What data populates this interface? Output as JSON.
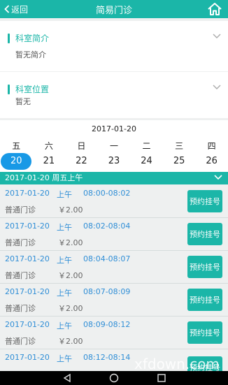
{
  "header": {
    "back_label": "返回",
    "title": "简易门诊"
  },
  "intro": {
    "title": "科室简介",
    "body": "暂无简介"
  },
  "location": {
    "title": "科室位置",
    "body": "暂无"
  },
  "calendar": {
    "selected_date": "2017-01-20",
    "weekdays": [
      "五",
      "六",
      "日",
      "一",
      "二",
      "三",
      "四"
    ],
    "days": [
      "20",
      "21",
      "22",
      "23",
      "24",
      "25",
      "26"
    ],
    "selected_index": 0
  },
  "period": {
    "label": "2017-01-20 周五上午"
  },
  "slots": [
    {
      "date": "2017-01-20",
      "ampm": "上午",
      "time": "08:00-08:02",
      "type": "普通门诊",
      "price": "￥2.00",
      "button": "预约挂号"
    },
    {
      "date": "2017-01-20",
      "ampm": "上午",
      "time": "08:02-08:04",
      "type": "普通门诊",
      "price": "￥2.00",
      "button": "预约挂号"
    },
    {
      "date": "2017-01-20",
      "ampm": "上午",
      "time": "08:04-08:07",
      "type": "普通门诊",
      "price": "￥2.00",
      "button": "预约挂号"
    },
    {
      "date": "2017-01-20",
      "ampm": "上午",
      "time": "08:07-08:09",
      "type": "普通门诊",
      "price": "￥2.00",
      "button": "预约挂号"
    },
    {
      "date": "2017-01-20",
      "ampm": "上午",
      "time": "08:09-08:12",
      "type": "普通门诊",
      "price": "￥2.00",
      "button": "预约挂号"
    },
    {
      "date": "2017-01-20",
      "ampm": "上午",
      "time": "08:12-08:14",
      "type": "",
      "price": "",
      "button": "预约挂号"
    }
  ],
  "watermark": "xfdown.com",
  "colors": {
    "brand": "#1bb6a8",
    "selected_day": "#1899e6",
    "slot_text": "#2f8ed6"
  }
}
